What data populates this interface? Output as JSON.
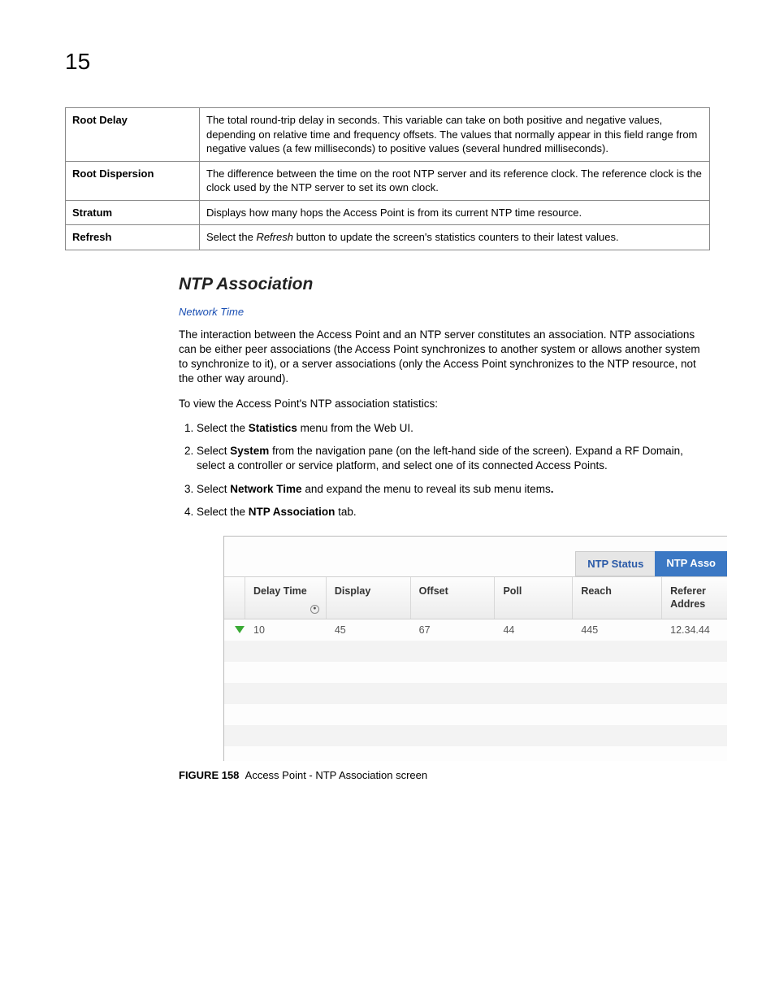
{
  "page_number": "15",
  "def_table": [
    {
      "term": "Root Delay",
      "desc": "The total round-trip delay in seconds. This variable can take on both positive and negative values, depending on relative time and frequency offsets. The values that normally appear in this field range from negative values (a few milliseconds) to positive values (several hundred milliseconds)."
    },
    {
      "term": "Root Dispersion",
      "desc": "The difference between the time on the root NTP server and its reference clock. The reference clock is the clock used by the NTP server to set its own clock."
    },
    {
      "term": "Stratum",
      "desc": "Displays how many hops the Access Point is from its current NTP time resource."
    },
    {
      "term": "Refresh",
      "desc_pre": "Select the ",
      "desc_em": "Refresh",
      "desc_post": " button to update the screen's statistics counters to their latest values."
    }
  ],
  "heading": "NTP Association",
  "breadcrumb": "Network Time",
  "intro": "The interaction between the Access Point and an NTP server constitutes an association. NTP associations can be either peer associations (the Access Point synchronizes to another system or allows another system to synchronize to it), or a server associations (only the Access Point synchronizes to the NTP resource, not the other way around).",
  "intro2": "To view the Access Point's NTP association statistics:",
  "steps": {
    "s1_a": "Select the ",
    "s1_b": "Statistics",
    "s1_c": " menu from the Web UI.",
    "s2_a": "Select ",
    "s2_b": "System",
    "s2_c": " from the navigation pane (on the left-hand side of the screen). Expand a RF Domain, select a controller or service platform, and select one of its connected Access Points.",
    "s3_a": "Select ",
    "s3_b": "Network Time",
    "s3_c": " and expand the menu to reveal its sub menu items",
    "s3_d": ".",
    "s4_a": "Select the ",
    "s4_b": "NTP Association",
    "s4_c": " tab."
  },
  "screenshot": {
    "tabs": {
      "inactive": "NTP Status",
      "active": "NTP Asso"
    },
    "headers": {
      "delay": "Delay Time",
      "display": "Display",
      "offset": "Offset",
      "poll": "Poll",
      "reach": "Reach",
      "ref": "Referer Addres"
    },
    "row": {
      "delay": "10",
      "display": "45",
      "offset": "67",
      "poll": "44",
      "reach": "445",
      "ref": "12.34.44"
    }
  },
  "figure": {
    "label": "FIGURE 158",
    "caption": "Access Point - NTP Association screen"
  }
}
